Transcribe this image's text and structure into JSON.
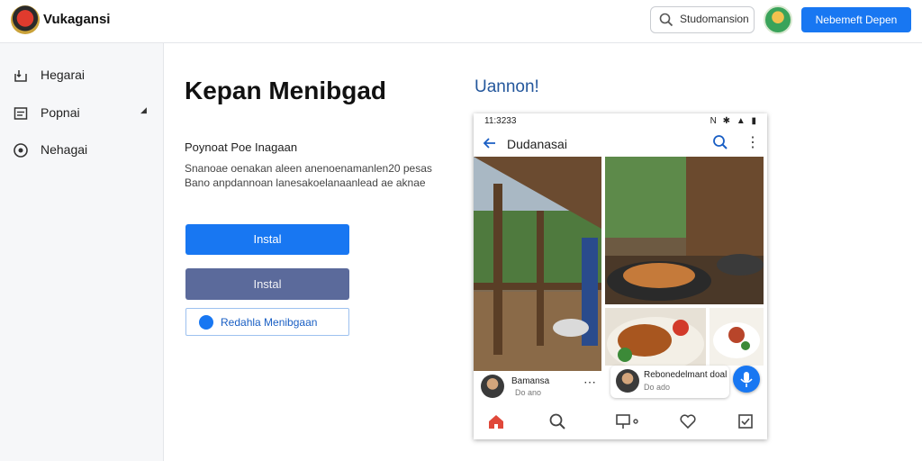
{
  "app": {
    "title": "Vukagansi"
  },
  "header": {
    "search_value": "Studomansion",
    "cta_label": "Nebemeft Depen"
  },
  "sidebar": {
    "items": [
      {
        "label": "Hegarai",
        "icon": "download-icon"
      },
      {
        "label": "Popnai",
        "icon": "document-icon"
      },
      {
        "label": "Nehagai",
        "icon": "compass-icon"
      }
    ]
  },
  "main": {
    "heading": "Kepan Menibgad",
    "subheading": "Poynoat Poe Inagaan",
    "description": "Snanoae oenakan aleen anenoenamanlen20 pesas Bano anpdannoan lanesakoelanaanlead ae aknae",
    "buttons": {
      "primary": "Instal",
      "secondary": "Instal",
      "outline": "Redahla Menibgaan"
    }
  },
  "preview": {
    "title": "Uannon!",
    "phone": {
      "status_time": "11:3233",
      "status_icons": "N ✱ ▲ ▮",
      "app_title": "Dudanasai",
      "post_left": {
        "name": "Bamansa",
        "meta": "Do ano"
      },
      "post_right": {
        "name": "Rebonedelmant doal",
        "meta": "Do ado"
      }
    }
  },
  "colors": {
    "accent": "#1877f2",
    "secondary_button": "#5b6a9b",
    "preview_title": "#24579c",
    "sidebar_bg": "#f6f7f9"
  }
}
